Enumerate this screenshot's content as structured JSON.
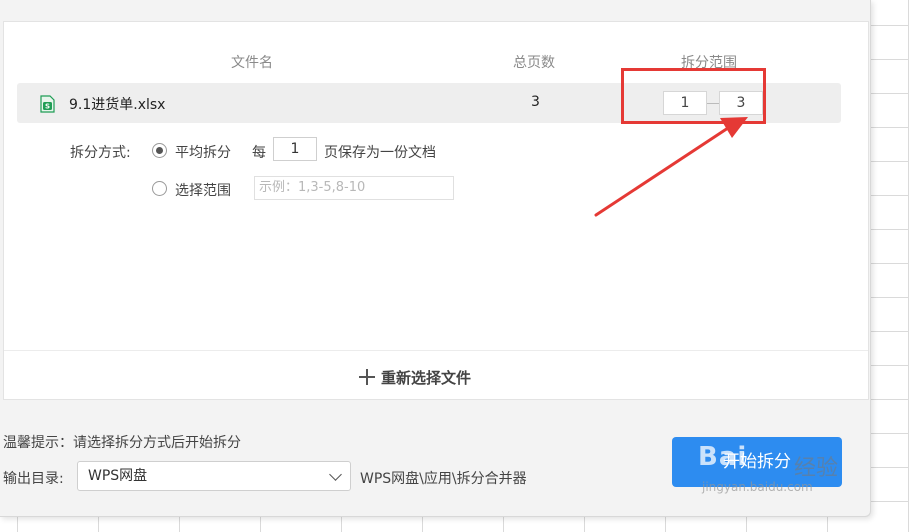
{
  "table": {
    "headers": {
      "file_name": "文件名",
      "total_pages": "总页数",
      "split_range": "拆分范围"
    },
    "row": {
      "file_name": "9.1进货单.xlsx",
      "total_pages": "3",
      "range_from": "1",
      "range_to": "3"
    }
  },
  "split_mode": {
    "label": "拆分方式:",
    "average": {
      "label": "平均拆分",
      "prefix": "每",
      "value": "1",
      "suffix": "页保存为一份文档",
      "selected": true
    },
    "range": {
      "label": "选择范围",
      "placeholder": "示例：1,3-5,8-10",
      "selected": false
    }
  },
  "reselect_label": "重新选择文件",
  "hint": "温馨提示：请选择拆分方式后开始拆分",
  "output": {
    "label": "输出目录:",
    "selected": "WPS网盘",
    "path": "WPS网盘\\应用\\拆分合并器"
  },
  "start_button": "开始拆分",
  "watermark": {
    "main": "Bai",
    "sub": "经验",
    "url": "jingyan.baidu.com"
  },
  "colors": {
    "primary": "#2d8cf0",
    "annotation": "#e53935",
    "excel_green": "#1f9d55"
  },
  "icons": {
    "file": "xlsx-file-icon",
    "add": "plus-icon",
    "dropdown": "chevron-down-icon"
  }
}
